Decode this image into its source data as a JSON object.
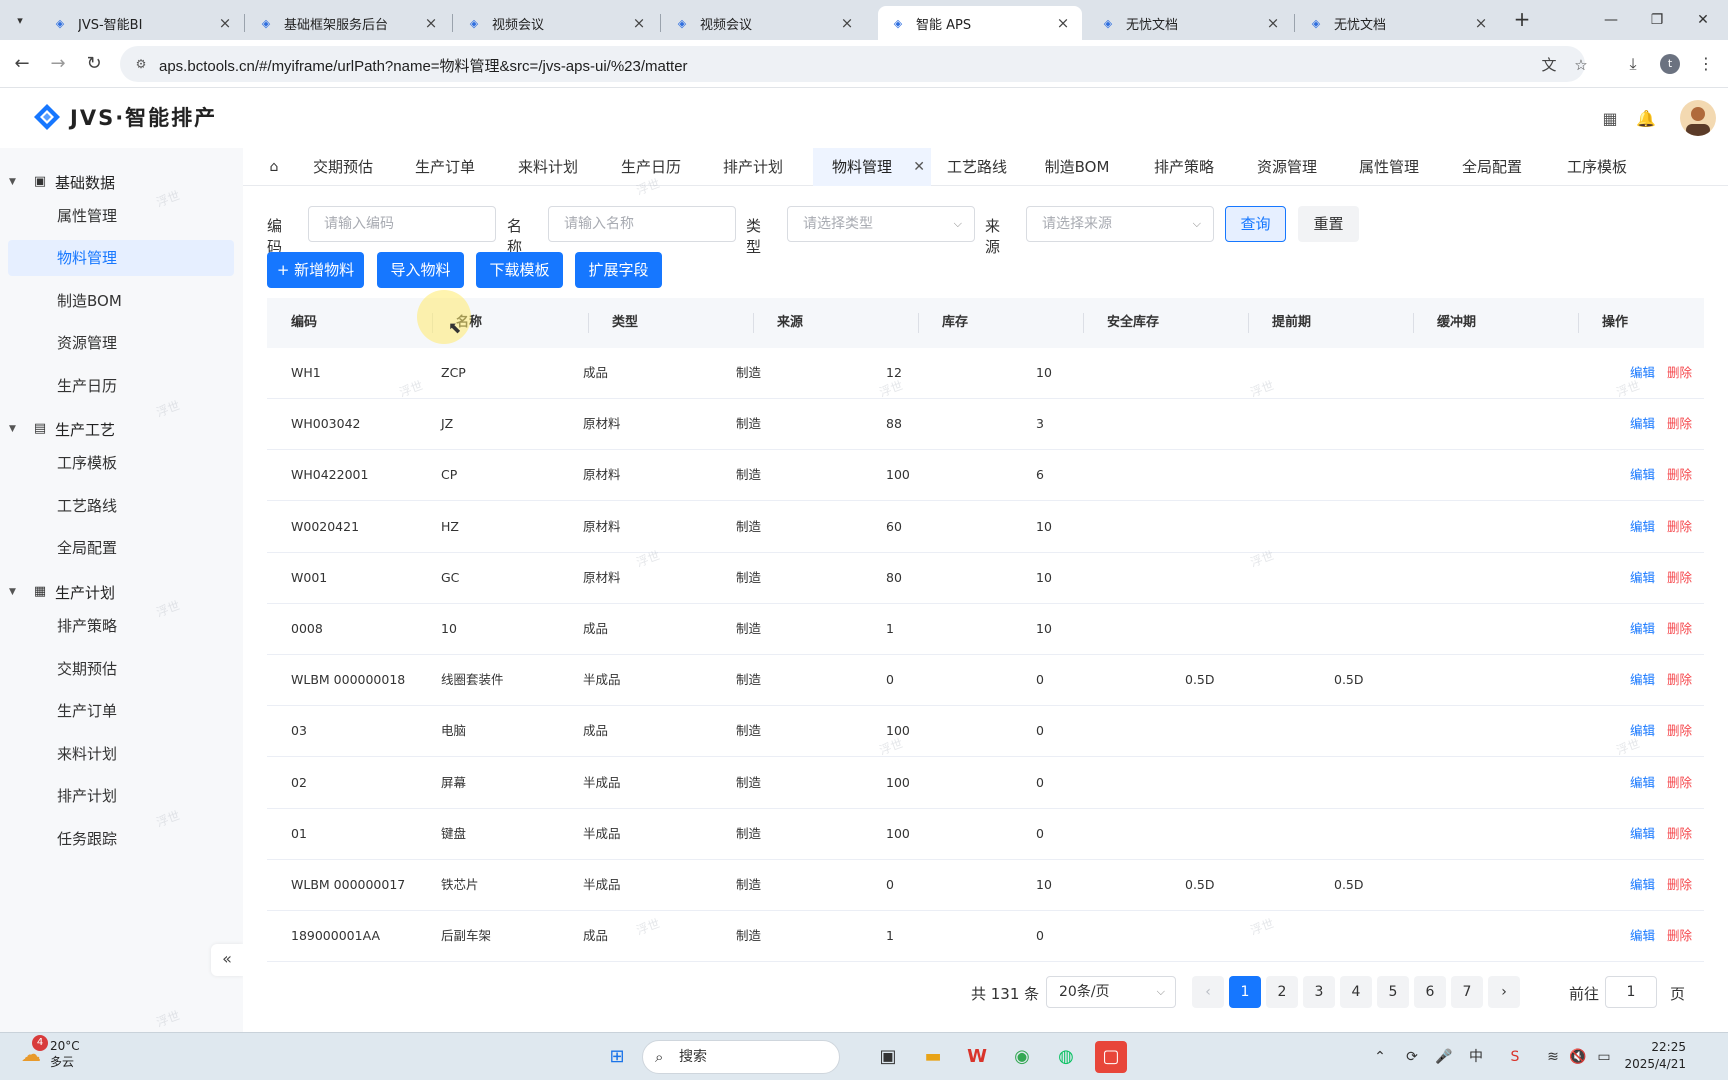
{
  "browser": {
    "tabs": [
      {
        "label": "JVS-智能BI",
        "active": false
      },
      {
        "label": "基础框架服务后台",
        "active": false
      },
      {
        "label": "视频会议",
        "active": false
      },
      {
        "label": "视频会议",
        "active": false
      },
      {
        "label": "智能 APS",
        "active": true
      },
      {
        "label": "无忧文档",
        "active": false
      },
      {
        "label": "无忧文档",
        "active": false
      }
    ],
    "url": "aps.bctools.cn/#/myiframe/urlPath?name=物料管理&src=/jvs-aps-ui/%23/matter",
    "profile_initial": "t"
  },
  "app": {
    "logo_text": "JVS·智能排产"
  },
  "sidebar": {
    "groups": [
      {
        "label": "基础数据",
        "items": [
          "属性管理",
          "物料管理",
          "制造BOM",
          "资源管理",
          "生产日历"
        ]
      },
      {
        "label": "生产工艺",
        "items": [
          "工序模板",
          "工艺路线",
          "全局配置"
        ]
      },
      {
        "label": "生产计划",
        "items": [
          "排产策略",
          "交期预估",
          "生产订单",
          "来料计划",
          "排产计划",
          "任务跟踪"
        ]
      }
    ],
    "active_item": "物料管理",
    "collapse_glyph": "«"
  },
  "page_tabs": [
    "交期预估",
    "生产订单",
    "来料计划",
    "生产日历",
    "排产计划",
    "物料管理",
    "工艺路线",
    "制造BOM",
    "排产策略",
    "资源管理",
    "属性管理",
    "全局配置",
    "工序模板"
  ],
  "active_page_tab": "物料管理",
  "filters": {
    "code_label": "编码",
    "code_placeholder": "请输入编码",
    "name_label": "名称",
    "name_placeholder": "请输入名称",
    "type_label": "类型",
    "type_placeholder": "请选择类型",
    "source_label": "来源",
    "source_placeholder": "请选择来源",
    "query_label": "查询",
    "reset_label": "重置"
  },
  "actions": {
    "add": "+ 新增物料",
    "import": "导入物料",
    "download": "下载模板",
    "extend": "扩展字段"
  },
  "table": {
    "columns": [
      "编码",
      "名称",
      "类型",
      "来源",
      "库存",
      "安全库存",
      "提前期",
      "缓冲期",
      "操作"
    ],
    "edit_label": "编辑",
    "delete_label": "删除",
    "rows": [
      [
        "WH1",
        "ZCP",
        "成品",
        "制造",
        "12",
        "10",
        "",
        ""
      ],
      [
        "WH003042",
        "JZ",
        "原材料",
        "制造",
        "88",
        "3",
        "",
        ""
      ],
      [
        "WH0422001",
        "CP",
        "原材料",
        "制造",
        "100",
        "6",
        "",
        ""
      ],
      [
        "W0020421",
        "HZ",
        "原材料",
        "制造",
        "60",
        "10",
        "",
        ""
      ],
      [
        "W001",
        "GC",
        "原材料",
        "制造",
        "80",
        "10",
        "",
        ""
      ],
      [
        "0008",
        "10",
        "成品",
        "制造",
        "1",
        "10",
        "",
        ""
      ],
      [
        "WLBM 000000018",
        "线圈套装件",
        "半成品",
        "制造",
        "0",
        "0",
        "0.5D",
        "0.5D"
      ],
      [
        "03",
        "电脑",
        "成品",
        "制造",
        "100",
        "0",
        "",
        ""
      ],
      [
        "02",
        "屏幕",
        "半成品",
        "制造",
        "100",
        "0",
        "",
        ""
      ],
      [
        "01",
        "键盘",
        "半成品",
        "制造",
        "100",
        "0",
        "",
        ""
      ],
      [
        "WLBM 000000017",
        "铁芯片",
        "半成品",
        "制造",
        "0",
        "10",
        "0.5D",
        "0.5D"
      ],
      [
        "189000001AA",
        "后副车架",
        "成品",
        "制造",
        "1",
        "0",
        "",
        ""
      ]
    ]
  },
  "pagination": {
    "total_text": "共 131 条",
    "page_size": "20条/页",
    "pages": [
      "1",
      "2",
      "3",
      "4",
      "5",
      "6",
      "7"
    ],
    "current_page": "1",
    "goto_label": "前往",
    "goto_value": "1",
    "page_unit": "页"
  },
  "watermark_text": "浮世",
  "taskbar": {
    "weather_badge": "4",
    "temperature": "20°C",
    "weather": "多云",
    "search_label": "搜索",
    "time": "22:25",
    "date": "2025/4/21",
    "ime": "中"
  },
  "colors": {
    "primary": "#1677ff",
    "danger": "#f5484d",
    "sidebar_bg": "#f7f8fa",
    "active_bg": "#e6efff"
  }
}
